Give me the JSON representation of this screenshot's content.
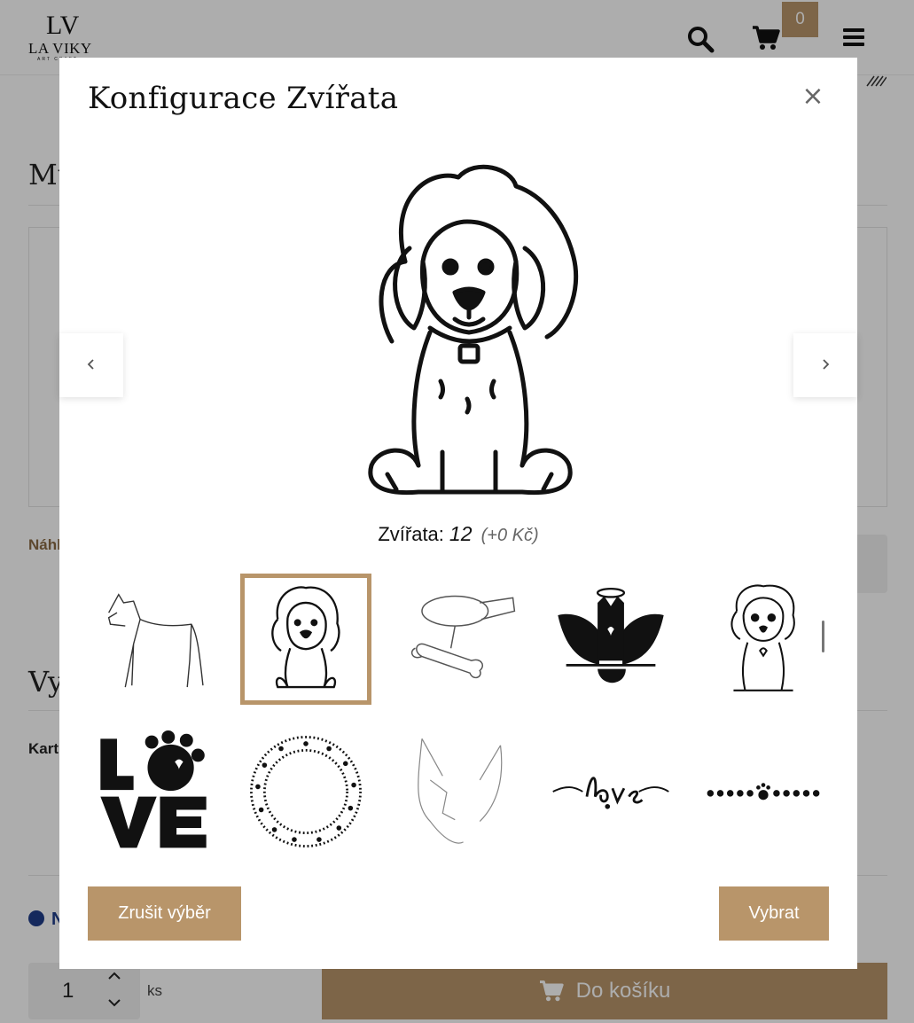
{
  "header": {
    "logo_monogram": "LV",
    "logo_word": "LA VIKY",
    "logo_sub": "ART CRAFT",
    "cart_count": "0",
    "icons": [
      "search-icon",
      "cart-icon",
      "menu-icon"
    ]
  },
  "background": {
    "heading_fragment": "Mů",
    "preview_label_fragment": "Náhl",
    "heading2_fragment": "Vy",
    "kart_fragment": "Kart",
    "n_fragment": "N",
    "quantity": "1",
    "quantity_unit": "ks",
    "add_to_cart_label": "Do košíku"
  },
  "modal": {
    "title": "Konfigurace Zvířata",
    "close_symbol": "×",
    "caption_label": "Zvířata:",
    "caption_value": "12",
    "caption_price": "(+0 Kč)",
    "thumbnails": [
      {
        "name": "great-dane"
      },
      {
        "name": "puppy-sitting",
        "selected": true
      },
      {
        "name": "collar-and-bone"
      },
      {
        "name": "angel-dog-wings"
      },
      {
        "name": "puppy-with-heart"
      },
      {
        "name": "love-paw"
      },
      {
        "name": "paw-wreath"
      },
      {
        "name": "dog-head-lineart"
      },
      {
        "name": "love-script"
      },
      {
        "name": "paw-border"
      }
    ],
    "clear_label": "Zrušit výběr",
    "select_label": "Vybrat"
  },
  "colors": {
    "accent": "#b8956a",
    "overlay": "rgba(0,0,0,0.32)",
    "badge_blue": "#1f3d8a"
  }
}
